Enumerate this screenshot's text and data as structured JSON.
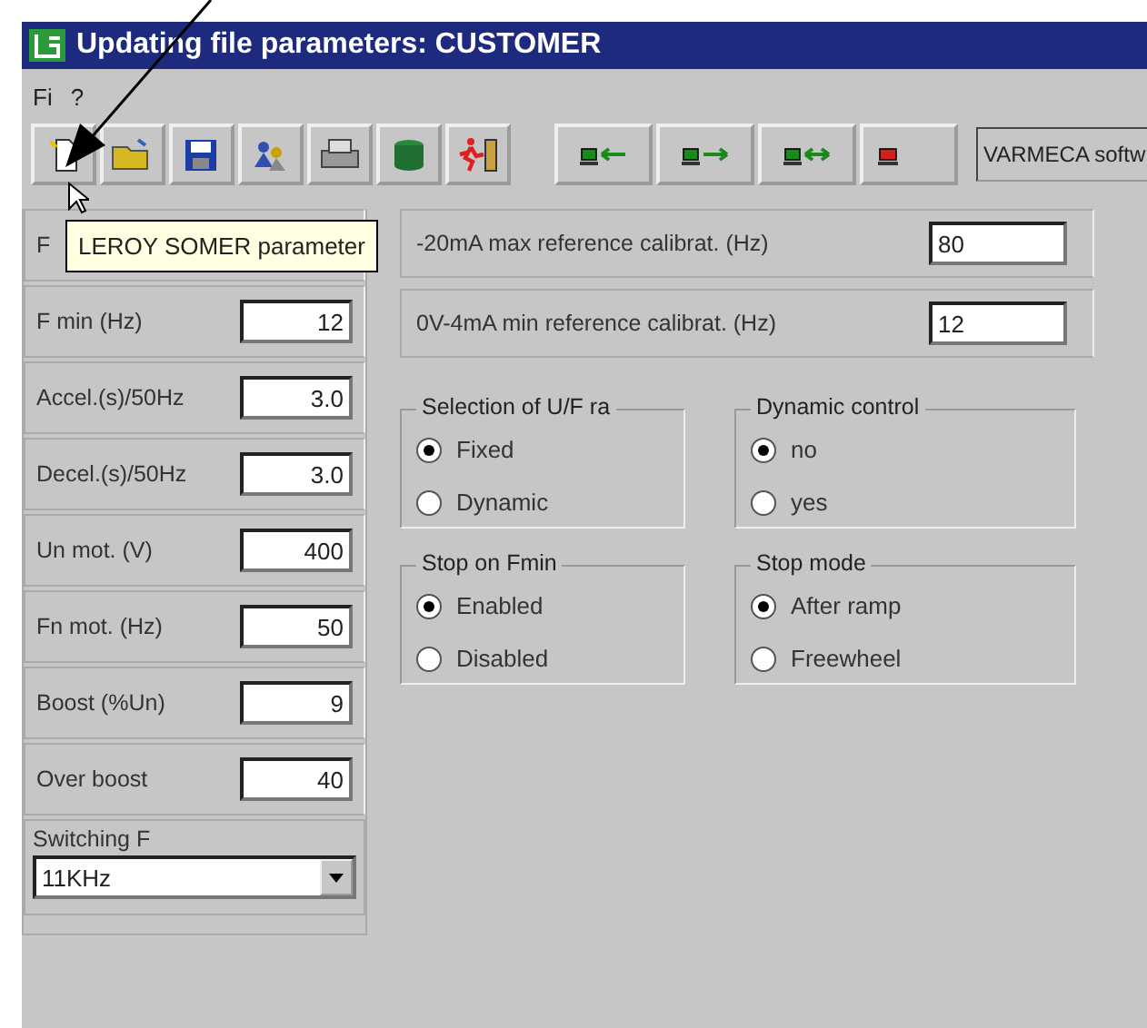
{
  "window": {
    "title": "Updating file parameters: CUSTOMER"
  },
  "menu": [
    "Fi",
    "?"
  ],
  "toolbar": {
    "status_text": "VARMECA softw"
  },
  "tooltip": "LEROY SOMER parameter",
  "parameters": [
    {
      "label": "F"
    },
    {
      "label": "F min (Hz)",
      "value": "12"
    },
    {
      "label": "Accel.(s)/50Hz",
      "value": "3.0"
    },
    {
      "label": "Decel.(s)/50Hz",
      "value": "3.0"
    },
    {
      "label": "Un mot. (V)",
      "value": "400"
    },
    {
      "label": "Fn mot. (Hz)",
      "value": "50"
    },
    {
      "label": "Boost (%Un)",
      "value": "9"
    },
    {
      "label": "Over boost",
      "value": "40"
    }
  ],
  "switching": {
    "label": "Switching F",
    "value": "11KHz"
  },
  "calibrations": [
    {
      "label": "-20mA max reference calibrat. (Hz)",
      "value": "80"
    },
    {
      "label": "0V-4mA min reference calibrat. (Hz)",
      "value": "12"
    }
  ],
  "groups": [
    {
      "title": "Selection of U/F ra",
      "options": [
        {
          "label": "Fixed",
          "selected": true
        },
        {
          "label": "Dynamic",
          "selected": false
        }
      ]
    },
    {
      "title": "Dynamic control",
      "options": [
        {
          "label": "no",
          "selected": true
        },
        {
          "label": "yes",
          "selected": false
        }
      ]
    },
    {
      "title": "Stop on Fmin",
      "options": [
        {
          "label": "Enabled",
          "selected": true
        },
        {
          "label": "Disabled",
          "selected": false
        }
      ]
    },
    {
      "title": "Stop mode",
      "options": [
        {
          "label": "After ramp",
          "selected": true
        },
        {
          "label": "Freewheel",
          "selected": false
        }
      ]
    }
  ]
}
